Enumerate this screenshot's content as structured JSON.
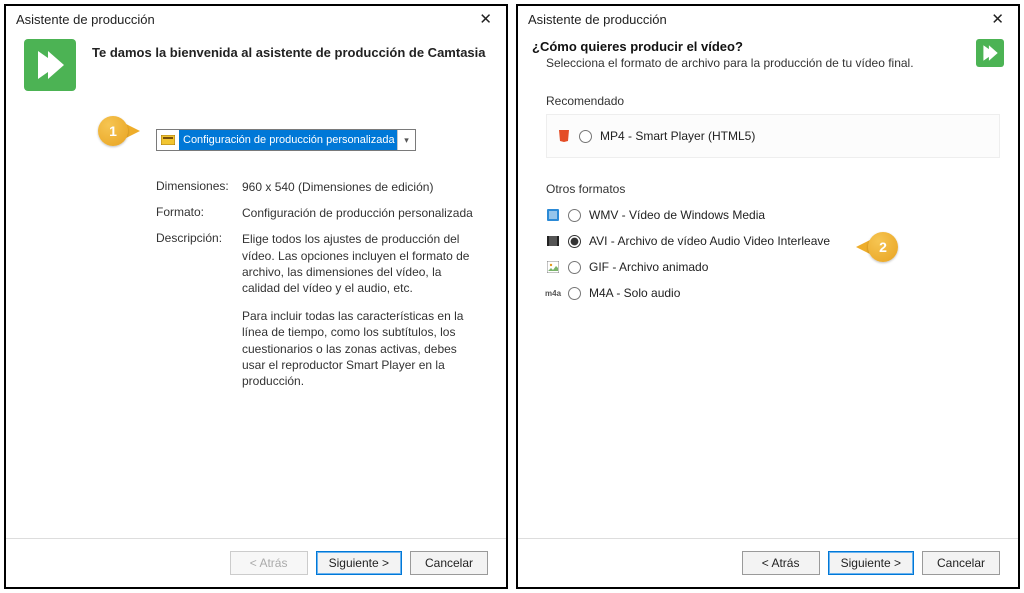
{
  "left": {
    "title": "Asistente de producción",
    "welcome": "Te damos la bienvenida al asistente de producción de Camtasia",
    "select_label": "Configuración de producción personalizada",
    "dim_key": "Dimensiones:",
    "dim_val": "960 x 540 (Dimensiones de edición)",
    "fmt_key": "Formato:",
    "fmt_val": "Configuración de producción personalizada",
    "desc_key": "Descripción:",
    "desc_p1": "Elige todos los ajustes de producción del vídeo. Las opciones incluyen el formato de archivo, las dimensiones del vídeo, la calidad del vídeo y el audio, etc.",
    "desc_p2": "Para incluir todas las características en la línea de tiempo, como los subtítulos, los cuestionarios o las zonas activas, debes usar el reproductor Smart Player en la producción.",
    "callout_num": "1",
    "buttons": {
      "back": "< Atrás",
      "next": "Siguiente >",
      "cancel": "Cancelar"
    }
  },
  "right": {
    "title": "Asistente de producción",
    "q_title": "¿Cómo quieres producir el vídeo?",
    "q_sub": "Selecciona el formato de archivo para la producción de tu vídeo final.",
    "rec_label": "Recomendado",
    "rec_option": "MP4 - Smart Player (HTML5)",
    "other_label": "Otros formatos",
    "opts": {
      "wmv": "WMV - Vídeo de Windows Media",
      "avi": "AVI - Archivo de vídeo Audio Video Interleave",
      "gif": "GIF - Archivo animado",
      "m4a": "M4A - Solo audio"
    },
    "callout_num": "2",
    "buttons": {
      "back": "< Atrás",
      "next": "Siguiente >",
      "cancel": "Cancelar"
    }
  }
}
